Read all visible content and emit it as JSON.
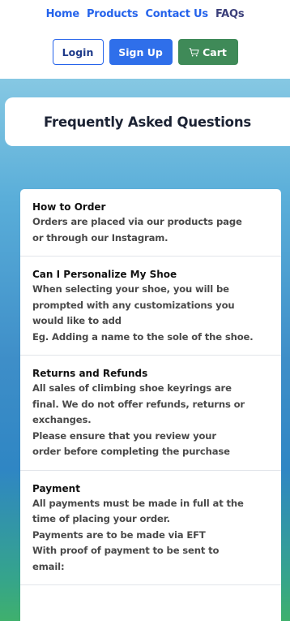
{
  "nav": {
    "links": [
      "Home",
      "Products",
      "Contact Us",
      "FAQs"
    ]
  },
  "header_buttons": {
    "login": "Login",
    "signup": "Sign Up",
    "cart": "Cart",
    "cart_icon": "cart-icon"
  },
  "page": {
    "title": "Frequently Asked Questions"
  },
  "faqs": [
    {
      "question": "How to Order",
      "answer": [
        "Orders are placed via our products page",
        "or through our Instagram."
      ]
    },
    {
      "question": "Can I Personalize My Shoe",
      "answer": [
        "When selecting your shoe, you will be",
        "prompted with any customizations you",
        "would like to add",
        "Eg. Adding a name to the sole of the shoe."
      ]
    },
    {
      "question": "Returns and Refunds",
      "answer": [
        "All sales of climbing shoe keyrings are",
        "final. We do not offer refunds, returns or",
        "exchanges.",
        "Please ensure that you review your",
        "order before completing the purchase"
      ]
    },
    {
      "question": "Payment",
      "answer": [
        "All payments must be made in full at the",
        "time of placing your order.",
        "Payments are to be made via EFT",
        "With proof of payment to be sent to",
        "email:"
      ]
    }
  ],
  "colors": {
    "nav_link": "#2563eb",
    "signup_bg": "#2f6fea",
    "cart_bg": "#3f8a58"
  }
}
